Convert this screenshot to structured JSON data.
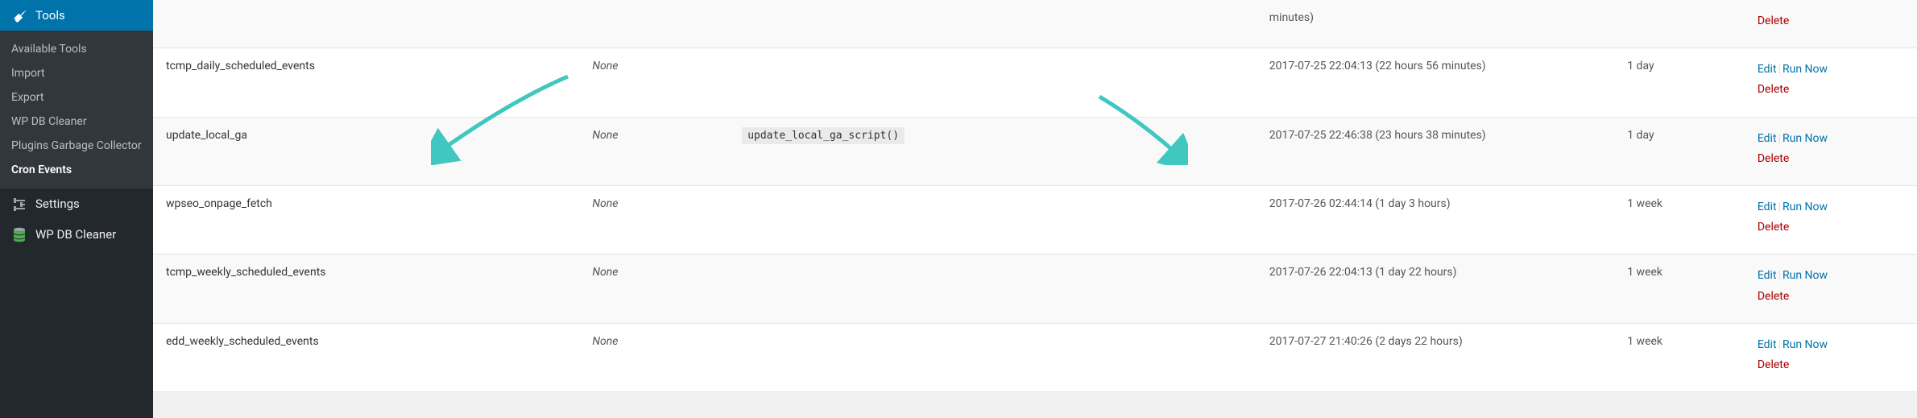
{
  "sidebar": {
    "tools_label": "Tools",
    "submenu": [
      {
        "label": "Available Tools",
        "current": false
      },
      {
        "label": "Import",
        "current": false
      },
      {
        "label": "Export",
        "current": false
      },
      {
        "label": "WP DB Cleaner",
        "current": false
      },
      {
        "label": "Plugins Garbage Collector",
        "current": false
      },
      {
        "label": "Cron Events",
        "current": true
      }
    ],
    "settings_label": "Settings",
    "wpdb_label": "WP DB Cleaner"
  },
  "table": {
    "none_text": "None",
    "edit": "Edit",
    "run_now": "Run Now",
    "delete": "Delete",
    "rows": [
      {
        "hook": "",
        "args": "",
        "action": "",
        "next": "minutes)",
        "recurrence": "",
        "partial": true
      },
      {
        "hook": "tcmp_daily_scheduled_events",
        "args": "None",
        "action": "",
        "next": "2017-07-25 22:04:13 (22 hours 56 minutes)",
        "recurrence": "1 day"
      },
      {
        "hook": "update_local_ga",
        "args": "None",
        "action": "update_local_ga_script()",
        "next": "2017-07-25 22:46:38 (23 hours 38 minutes)",
        "recurrence": "1 day"
      },
      {
        "hook": "wpseo_onpage_fetch",
        "args": "None",
        "action": "",
        "next": "2017-07-26 02:44:14 (1 day 3 hours)",
        "recurrence": "1 week"
      },
      {
        "hook": "tcmp_weekly_scheduled_events",
        "args": "None",
        "action": "",
        "next": "2017-07-26 22:04:13 (1 day 22 hours)",
        "recurrence": "1 week"
      },
      {
        "hook": "edd_weekly_scheduled_events",
        "args": "None",
        "action": "",
        "next": "2017-07-27 21:40:26 (2 days 22 hours)",
        "recurrence": "1 week"
      }
    ]
  },
  "colors": {
    "accent": "#0073aa",
    "danger": "#a00",
    "annotation": "#3fc7c0"
  }
}
